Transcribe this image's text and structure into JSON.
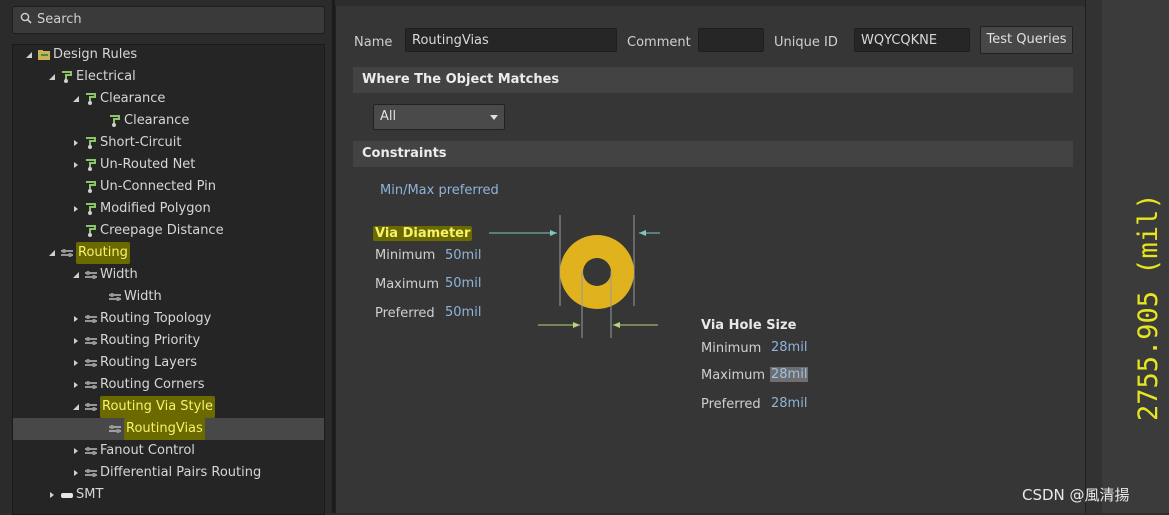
{
  "search": {
    "placeholder": "Search"
  },
  "tree": [
    {
      "label": "Design Rules",
      "level": 0,
      "expanded": true,
      "icon": "design-rules-icon"
    },
    {
      "label": "Electrical",
      "level": 1,
      "expanded": true,
      "icon": "rule-category-icon"
    },
    {
      "label": "Clearance",
      "level": 2,
      "expanded": true,
      "icon": "rule-icon"
    },
    {
      "label": "Clearance",
      "level": 3,
      "expanded": null,
      "icon": "rule-icon"
    },
    {
      "label": "Short-Circuit",
      "level": 2,
      "expanded": false,
      "icon": "rule-icon"
    },
    {
      "label": "Un-Routed Net",
      "level": 2,
      "expanded": false,
      "icon": "rule-icon"
    },
    {
      "label": "Un-Connected Pin",
      "level": 2,
      "expanded": null,
      "icon": "rule-icon"
    },
    {
      "label": "Modified Polygon",
      "level": 2,
      "expanded": false,
      "icon": "rule-icon"
    },
    {
      "label": "Creepage Distance",
      "level": 2,
      "expanded": null,
      "icon": "rule-icon"
    },
    {
      "label": "Routing",
      "level": 1,
      "expanded": true,
      "icon": "routing-icon",
      "highlight": true
    },
    {
      "label": "Width",
      "level": 2,
      "expanded": true,
      "icon": "routing-icon"
    },
    {
      "label": "Width",
      "level": 3,
      "expanded": null,
      "icon": "routing-icon"
    },
    {
      "label": "Routing Topology",
      "level": 2,
      "expanded": false,
      "icon": "routing-icon"
    },
    {
      "label": "Routing Priority",
      "level": 2,
      "expanded": false,
      "icon": "routing-icon"
    },
    {
      "label": "Routing Layers",
      "level": 2,
      "expanded": false,
      "icon": "routing-icon"
    },
    {
      "label": "Routing Corners",
      "level": 2,
      "expanded": false,
      "icon": "routing-icon"
    },
    {
      "label": "Routing Via Style",
      "level": 2,
      "expanded": true,
      "icon": "routing-icon",
      "highlight": true
    },
    {
      "label": "RoutingVias",
      "level": 3,
      "expanded": null,
      "icon": "routing-icon",
      "highlight": true,
      "selected": true
    },
    {
      "label": "Fanout Control",
      "level": 2,
      "expanded": false,
      "icon": "routing-icon"
    },
    {
      "label": "Differential Pairs Routing",
      "level": 2,
      "expanded": false,
      "icon": "routing-icon"
    },
    {
      "label": "SMT",
      "level": 1,
      "expanded": false,
      "icon": "smt-icon"
    }
  ],
  "header": {
    "name_label": "Name",
    "name_value": "RoutingVias",
    "comment_label": "Comment",
    "comment_value": "",
    "uid_label": "Unique ID",
    "uid_value": "WQYCQKNE",
    "test_queries": "Test Queries"
  },
  "where": {
    "title": "Where The Object Matches",
    "selected": "All"
  },
  "constraints": {
    "title": "Constraints",
    "mode": "Min/Max preferred",
    "via_diameter": {
      "title": "Via Diameter",
      "min_label": "Minimum",
      "min": "50mil",
      "max_label": "Maximum",
      "max": "50mil",
      "pref_label": "Preferred",
      "pref": "50mil"
    },
    "via_hole": {
      "title": "Via Hole Size",
      "min_label": "Minimum",
      "min": "28mil",
      "max_label": "Maximum",
      "max": "28mil",
      "pref_label": "Preferred",
      "pref": "28mil"
    }
  },
  "canvas": {
    "coord_text": "2755.905 (mil)"
  },
  "watermark": "CSDN @風清揚",
  "colors": {
    "highlight": "#f6f36a",
    "via_copper": "#e0b21e",
    "value_blue": "#8fb3d9"
  }
}
